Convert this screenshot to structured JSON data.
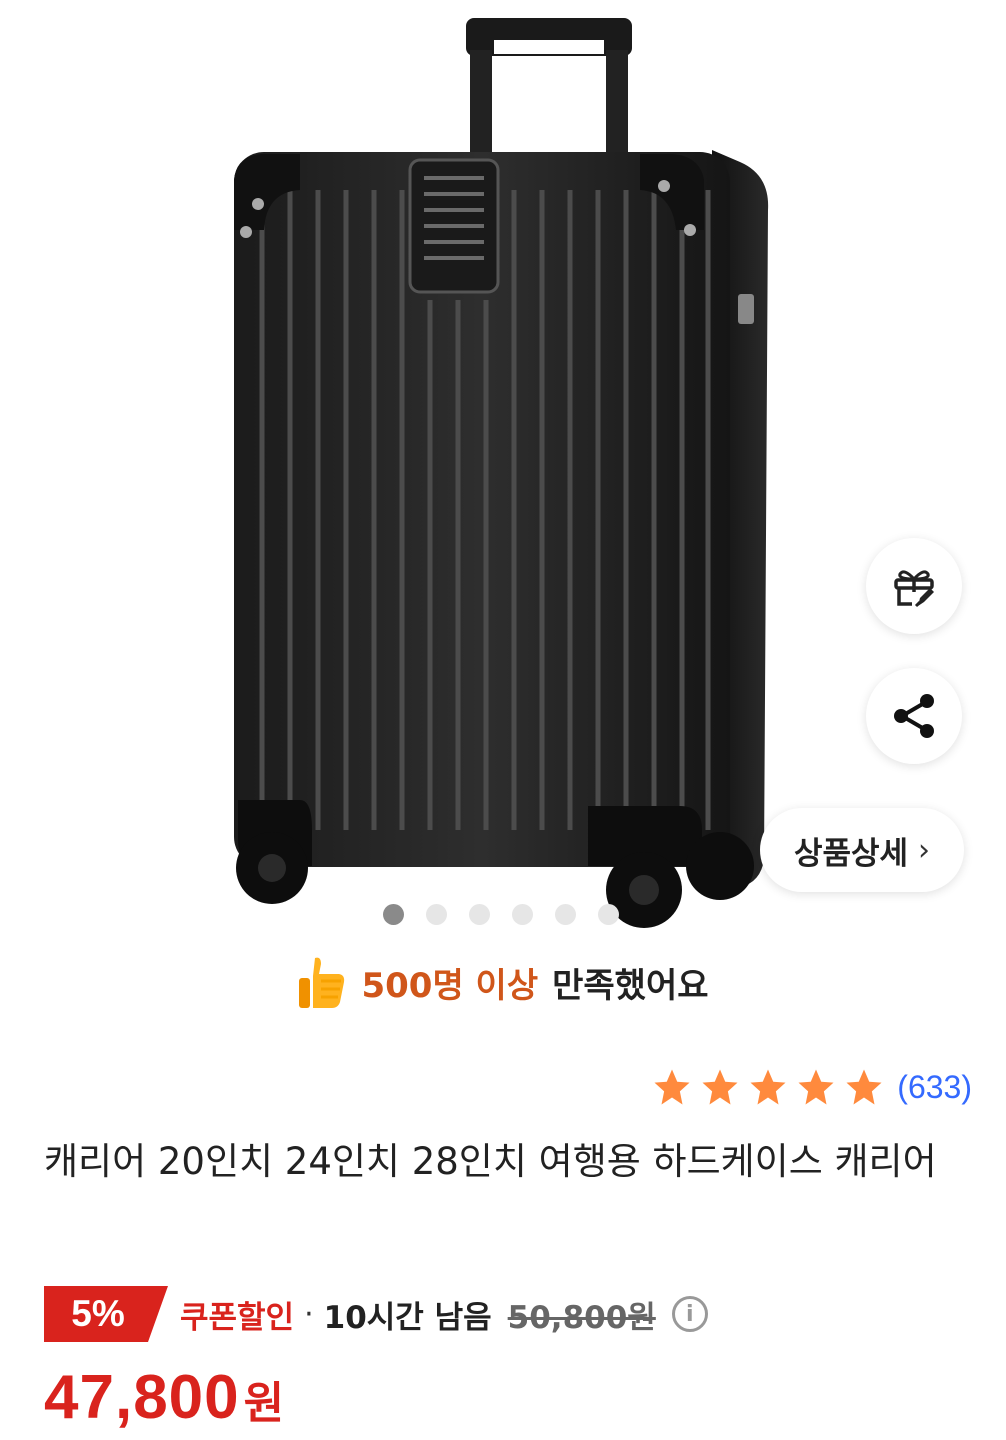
{
  "product": {
    "title": "캐리어 20인치 24인치 28인치 여행용 하드케이스 캐리어",
    "image_dots": 6,
    "active_dot": 0
  },
  "actions": {
    "gift_icon": "gift-rocket-icon",
    "share_icon": "share-icon",
    "detail_label": "상품상세",
    "detail_chevron": "›"
  },
  "satisfaction": {
    "highlight": "500명 이상",
    "rest": "만족했어요",
    "icon": "thumbs-up-icon"
  },
  "rating": {
    "stars": 5,
    "review_count": "(633)"
  },
  "price": {
    "discount": "5%",
    "coupon_label": "쿠폰할인",
    "separator": "·",
    "time_left": "10시간 남음",
    "original": "50,800원",
    "final_number": "47,800",
    "final_unit": "원",
    "info_glyph": "i"
  },
  "colors": {
    "accent_red": "#d9231d",
    "highlight_orange": "#d0561a",
    "star_orange": "#ff8a3d",
    "link_blue": "#346aff"
  }
}
